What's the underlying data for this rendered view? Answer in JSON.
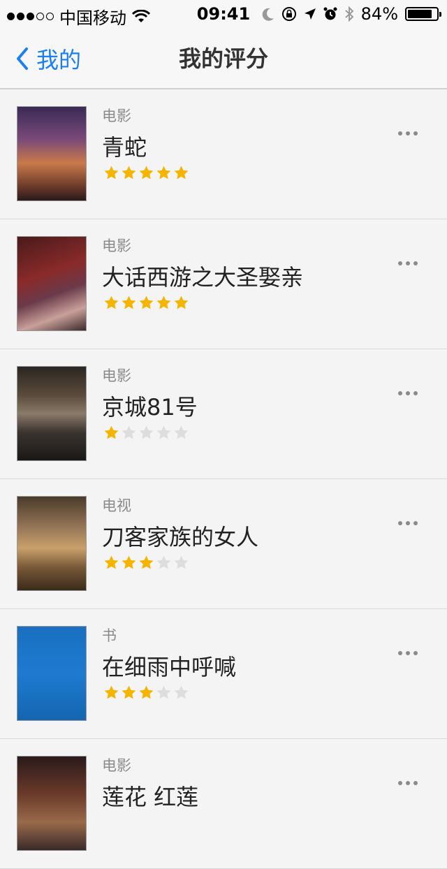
{
  "status_bar": {
    "carrier": "中国移动",
    "time": "09:41",
    "battery": "84%",
    "battery_level": 0.84,
    "signal_dots_filled": 3,
    "signal_dots_total": 5,
    "icons": [
      "wifi-icon",
      "moon-icon",
      "rotation-lock-icon",
      "location-arrow-icon",
      "alarm-icon",
      "bluetooth-icon"
    ]
  },
  "nav": {
    "back_label": "我的",
    "title": "我的评分"
  },
  "colors": {
    "accent": "#1a7ff5",
    "star_on": "#f5b400",
    "star_off": "#dddddd"
  },
  "items": [
    {
      "category": "电影",
      "title": "青蛇",
      "rating": 5,
      "max_rating": 5
    },
    {
      "category": "电影",
      "title": "大话西游之大圣娶亲",
      "rating": 5,
      "max_rating": 5
    },
    {
      "category": "电影",
      "title": "京城81号",
      "rating": 1,
      "max_rating": 5
    },
    {
      "category": "电视",
      "title": "刀客家族的女人",
      "rating": 3,
      "max_rating": 5
    },
    {
      "category": "书",
      "title": "在细雨中呼喊",
      "rating": 3,
      "max_rating": 5
    },
    {
      "category": "电影",
      "title": "莲花 红莲",
      "rating": 0,
      "max_rating": 5
    }
  ]
}
